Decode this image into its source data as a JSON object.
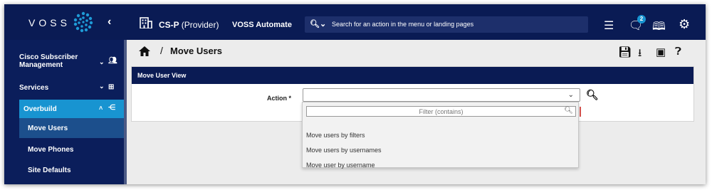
{
  "brand": {
    "logo_text": "VOSS"
  },
  "topbar": {
    "tenant_name": "CS-P",
    "tenant_type": "(Provider)",
    "app_name": "VOSS Automate",
    "search_placeholder": "Search for an action in the menu or landing pages",
    "notification_count": "2",
    "icons": [
      "list-icon",
      "chat-icon",
      "book-icon",
      "gear-icon"
    ]
  },
  "sidebar": {
    "items": [
      {
        "label": "Cisco Subscriber Management",
        "icon": "users-icon"
      },
      {
        "label": "Services",
        "icon": "plus-box-icon"
      },
      {
        "label": "Overbuild",
        "icon": "collapse-menu-icon",
        "expanded": true
      }
    ],
    "subitems": [
      {
        "label": "Move Users",
        "selected": true
      },
      {
        "label": "Move Phones"
      },
      {
        "label": "Site Defaults"
      }
    ]
  },
  "breadcrumb": {
    "separator": "/",
    "title": "Move Users"
  },
  "form": {
    "panel_title": "Move User View",
    "field_label": "Action *",
    "value": ""
  },
  "dropdown": {
    "filter_placeholder": "Filter (contains)",
    "options": [
      "Move users by filters",
      "Move users by usernames",
      "Move user by username"
    ]
  },
  "colors": {
    "navy": "#0a1b54",
    "accent": "#1894d1",
    "selected": "#1c4f8c"
  }
}
